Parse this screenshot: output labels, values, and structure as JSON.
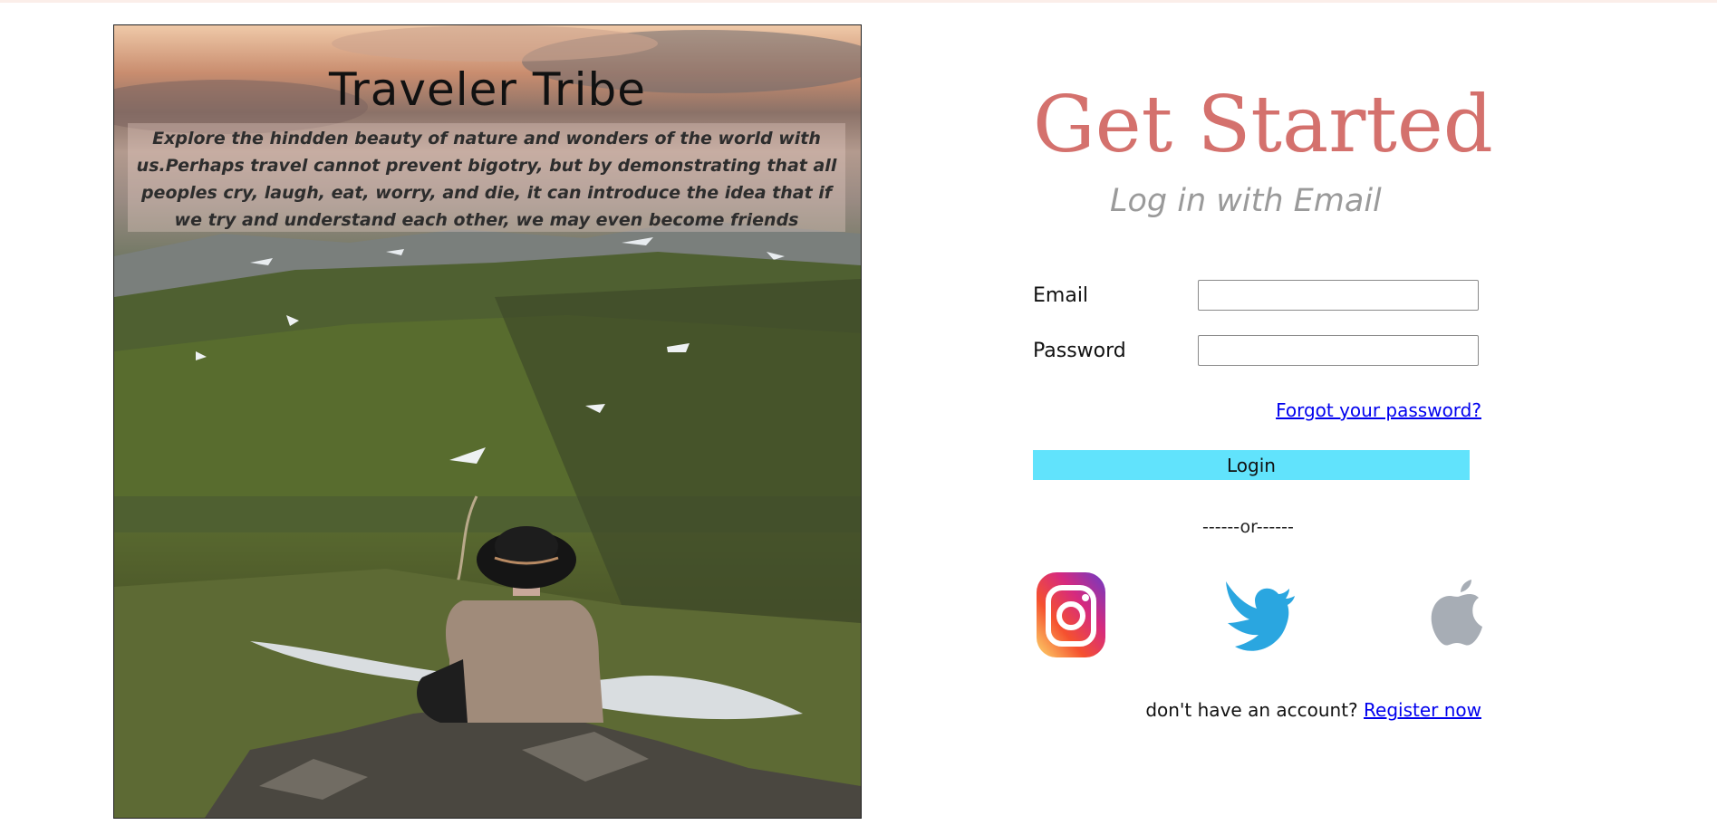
{
  "hero": {
    "title": "Traveler Tribe",
    "blurb": "Explore the hindden beauty of nature and wonders of the world with us.Perhaps travel cannot prevent bigotry, but by demonstrating that all peoples cry, laugh, eat, worry, and die, it can introduce the idea that if we try and understand each other, we may even become friends"
  },
  "login": {
    "heading": "Get Started",
    "subtitle": "Log in with Email",
    "email_label": "Email",
    "email_value": "",
    "password_label": "Password",
    "password_value": "",
    "forgot_link": "Forgot your password?",
    "login_button": "Login",
    "divider": "------or------",
    "socials": [
      {
        "icon": "instagram-icon"
      },
      {
        "icon": "twitter-icon"
      },
      {
        "icon": "apple-icon"
      }
    ],
    "signup_prompt": "don't have an account?",
    "signup_link": "Register now"
  },
  "colors": {
    "heading": "#d4716d",
    "subtitle": "#9a9a9a",
    "login_button": "#61e3fc",
    "link": "#0000ee",
    "twitter": "#2aa6e0",
    "apple": "#a7adb5"
  }
}
